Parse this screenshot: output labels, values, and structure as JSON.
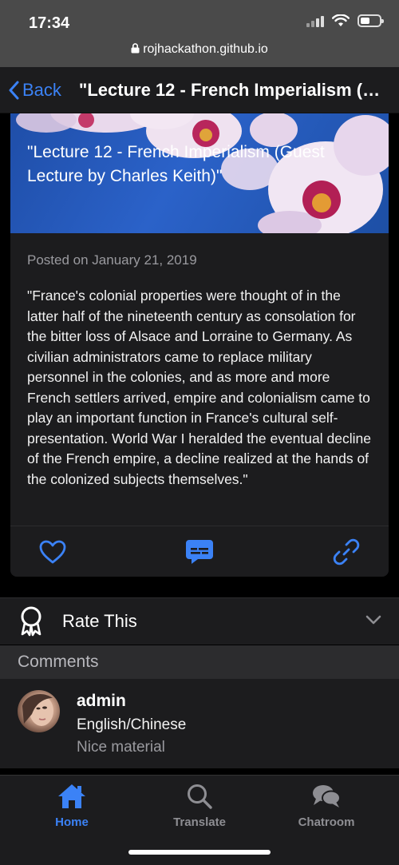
{
  "status": {
    "time": "17:34",
    "url": "rojhackathon.github.io"
  },
  "nav": {
    "back_label": "Back",
    "title": "\"Lecture 12 - French Imperialism (Guest Lecture by Charles Keith)\""
  },
  "post": {
    "hero_title": "\"Lecture 12 - French Imperialism (Guest Lecture by Charles Keith)\"",
    "posted": "Posted on January 21, 2019",
    "body": "\"France's colonial properties were thought of in the latter half of the nineteenth century as consolation for the bitter loss of Alsace and Lorraine to Germany. As civilian administrators came to replace military personnel in the colonies, and as more and more French settlers arrived, empire and colonialism came to play an important function in France's cultural self-presentation. World War I heralded the eventual decline of the French empire, a decline realized at the hands of the colonized subjects themselves.\"",
    "actions": [
      "heart-icon",
      "comment-icon",
      "link-icon"
    ]
  },
  "rate": {
    "label": "Rate This"
  },
  "comments": {
    "header": "Comments",
    "items": [
      {
        "name": "admin",
        "language": "English/Chinese",
        "text": "Nice material"
      }
    ]
  },
  "tabs": [
    {
      "label": "Home",
      "icon": "home-icon",
      "active": true
    },
    {
      "label": "Translate",
      "icon": "search-icon",
      "active": false
    },
    {
      "label": "Chatroom",
      "icon": "chat-icon",
      "active": false
    }
  ],
  "colors": {
    "accent": "#3b82f6",
    "inactive": "#8e8e93",
    "surface": "#1c1c1e"
  }
}
